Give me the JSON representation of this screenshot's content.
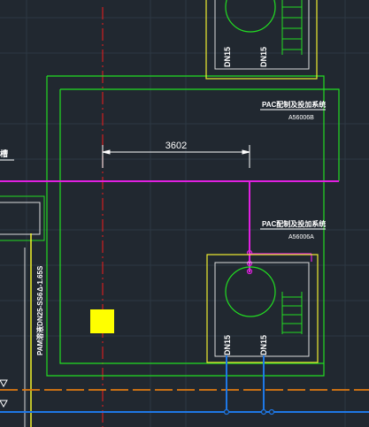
{
  "drawing": {
    "dimension_value": "3602",
    "system_label_top": "PAC配制及投加系统",
    "tag_top": "A56006B",
    "system_label_mid": "PAC配制及投加系统",
    "tag_mid": "A56006A",
    "left_cut_label": "槽",
    "vertical_pipe_label": "PAM溶液DN25-SS6",
    "elevation_label": "Δ-1.65S",
    "pipe_labels_top_unit": [
      "DN15",
      "DN15"
    ],
    "pipe_labels_bottom_unit": [
      "DN15",
      "DN15"
    ]
  },
  "colors": {
    "background": "#212830",
    "grid": "#2e3a45",
    "wall_green": "#20e020",
    "equipment_yellow": "#f4f42a",
    "pipe_magenta": "#e020e0",
    "pipe_blue": "#1e78e6",
    "pipe_orange": "#e07a10",
    "centerline_red": "#d02020",
    "dimension_white": "#ffffff",
    "marker_fill": "#ffff00"
  }
}
